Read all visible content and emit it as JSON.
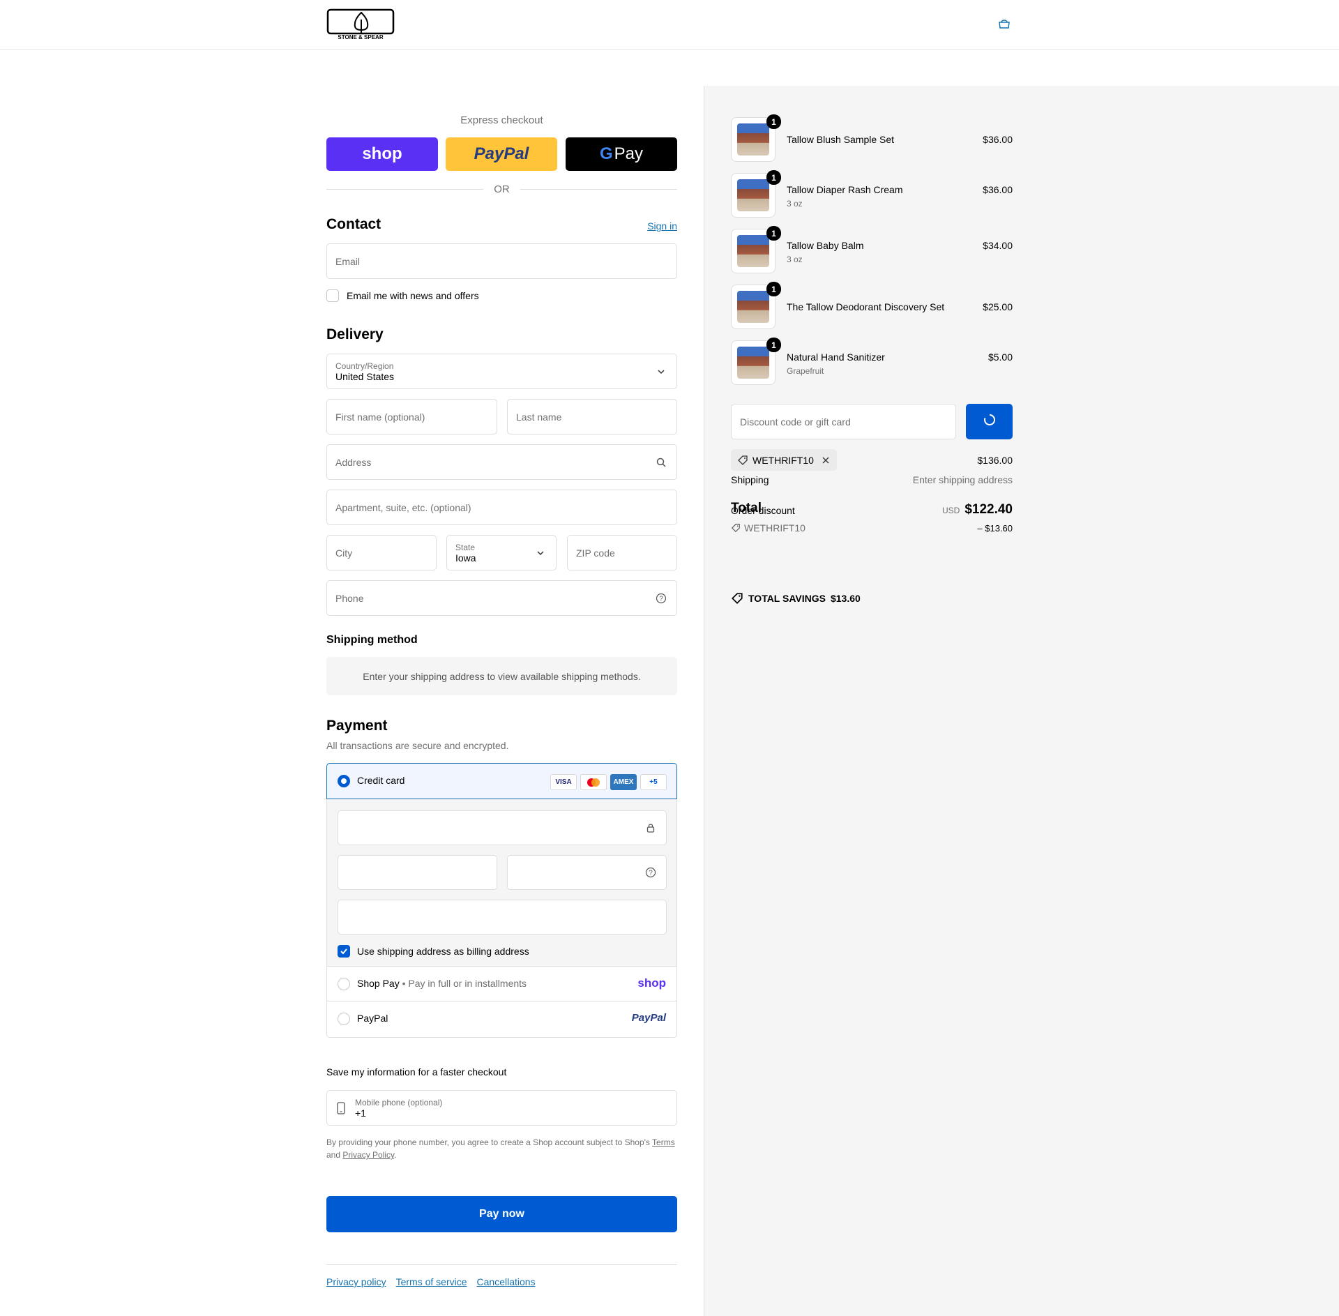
{
  "brand": {
    "logo_text": "STONE & SPEAR"
  },
  "express": {
    "title": "Express checkout",
    "shop_label": "shop",
    "paypal_label": "PayPal",
    "gpay_label": "Pay",
    "or_text": "OR"
  },
  "contact": {
    "title": "Contact",
    "sign_in": "Sign in",
    "email_placeholder": "Email",
    "newsletter_label": "Email me with news and offers"
  },
  "delivery": {
    "title": "Delivery",
    "country_label": "Country/Region",
    "country_value": "United States",
    "first_name_placeholder": "First name (optional)",
    "last_name_placeholder": "Last name",
    "address_placeholder": "Address",
    "apartment_placeholder": "Apartment, suite, etc. (optional)",
    "city_placeholder": "City",
    "state_label": "State",
    "state_value": "Iowa",
    "zip_placeholder": "ZIP code",
    "phone_placeholder": "Phone"
  },
  "shipping_method": {
    "title": "Shipping method",
    "note": "Enter your shipping address to view available shipping methods."
  },
  "payment": {
    "title": "Payment",
    "subtitle": "All transactions are secure and encrypted.",
    "credit_card_label": "Credit card",
    "card_brands": [
      "VISA",
      "MC",
      "AMEX",
      "+5"
    ],
    "billing_same_label": "Use shipping address as billing address",
    "shop_pay_label": "Shop Pay",
    "shop_pay_sub": "Pay in full or in installments",
    "shop_pay_brand": "shop",
    "paypal_label": "PayPal",
    "paypal_brand": "PayPal"
  },
  "save_info": {
    "title": "Save my information for a faster checkout",
    "mobile_label": "Mobile phone (optional)",
    "mobile_value": "+1",
    "legal_1": "By providing your phone number, you agree to create a Shop account subject to Shop's",
    "terms_link": "Terms",
    "legal_and": "and",
    "privacy_link": "Privacy Policy",
    "legal_end": "."
  },
  "pay_now": "Pay now",
  "footer": {
    "links": [
      "Privacy policy",
      "Terms of service",
      "Cancellations"
    ]
  },
  "order": {
    "items": [
      {
        "name": "Tallow Blush Sample Set",
        "variant": "",
        "price": "$36.00",
        "qty": "1"
      },
      {
        "name": "Tallow Diaper Rash Cream",
        "variant": "3 oz",
        "price": "$36.00",
        "qty": "1"
      },
      {
        "name": "Tallow Baby Balm",
        "variant": "3 oz",
        "price": "$34.00",
        "qty": "1"
      },
      {
        "name": "The Tallow Deodorant Discovery Set",
        "variant": "",
        "price": "$25.00",
        "qty": "1"
      },
      {
        "name": "Natural Hand Sanitizer",
        "variant": "Grapefruit",
        "price": "$5.00",
        "qty": "1"
      }
    ],
    "discount_placeholder": "Discount code or gift card",
    "applied_code": "WETHRIFT10",
    "subtotal": "$136.00",
    "shipping_label": "Shipping",
    "shipping_value": "Enter shipping address",
    "order_discount_label": "Order discount",
    "discount_code": "WETHRIFT10",
    "discount_amount": "– $13.60",
    "total_label": "Total",
    "currency": "USD",
    "total": "$122.40",
    "savings_label": "TOTAL SAVINGS",
    "savings_value": "$13.60"
  },
  "colors": {
    "primary": "#005bd3",
    "link": "#1773b0",
    "shop": "#5a31f4",
    "paypal": "#ffc439",
    "sidebar": "#f5f5f5"
  }
}
